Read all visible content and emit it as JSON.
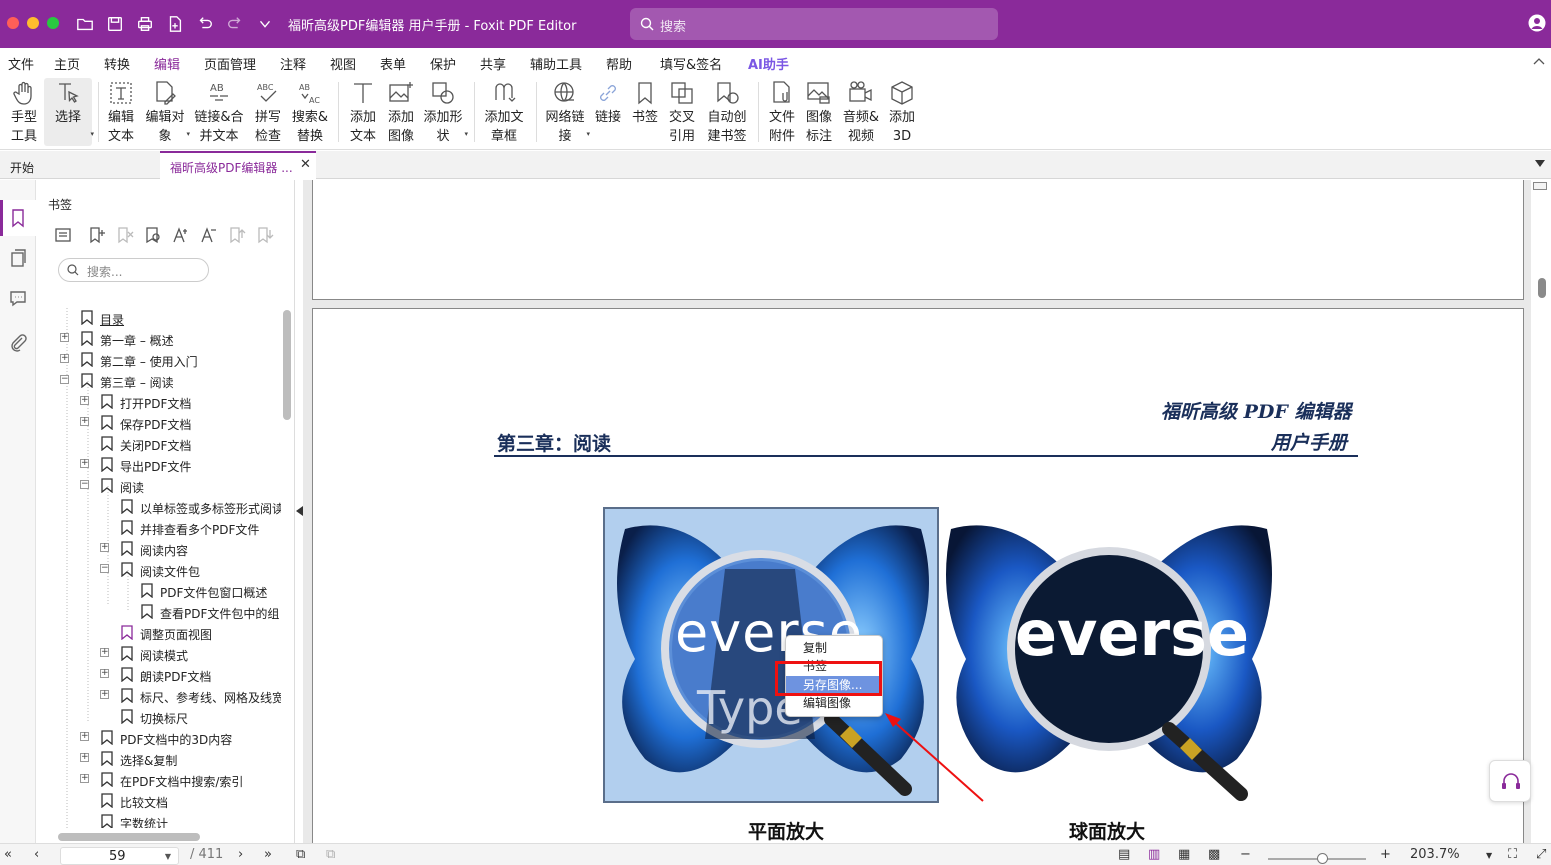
{
  "window": {
    "title": "福昕高级PDF编辑器 用户手册 - Foxit PDF Editor",
    "search_placeholder": "搜索",
    "colors": {
      "brand": "#8a2a9a",
      "close": "#ff5f57",
      "minimize": "#febc2e",
      "zoom": "#28c840"
    }
  },
  "menu": {
    "items": [
      "文件",
      "主页",
      "转换",
      "编辑",
      "页面管理",
      "注释",
      "视图",
      "表单",
      "保护",
      "共享",
      "辅助工具",
      "帮助",
      "填写&签名",
      "AI助手"
    ],
    "active": "编辑"
  },
  "ribbon": {
    "hand": "手型\n工具",
    "select": "选择",
    "edit_text": "编辑\n文本",
    "edit_object": "编辑对\n象",
    "link_merge": "链接&合\n并文本",
    "spell_check": "拼写\n检查",
    "search_replace": "搜索&\n替换",
    "add_text": "添加\n文本",
    "add_image": "添加\n图像",
    "add_shape": "添加形\n状",
    "add_text_box": "添加文\n章框",
    "web_links": "网络链\n接",
    "link": "链接",
    "bookmark": "书签",
    "cross_ref": "交叉\n引用",
    "auto_bookmark": "自动创\n建书签",
    "file_attachment": "文件\n附件",
    "image_annotation": "图像\n标注",
    "audio_video": "音频&\n视频",
    "add_3d": "添加\n3D"
  },
  "tabs": {
    "home": "开始",
    "document": "福昕高级PDF编辑器 ..."
  },
  "bookmarks": {
    "title": "书签",
    "search_placeholder": "搜索...",
    "items": [
      "目录",
      "第一章 – 概述",
      "第二章 – 使用入门",
      "第三章 – 阅读",
      "打开PDF文档",
      "保存PDF文档",
      "关闭PDF文档",
      "导出PDF文件",
      "阅读",
      "以单标签或多标签形式阅读",
      "并排查看多个PDF文件",
      "阅读内容",
      "阅读文件包",
      "PDF文件包窗口概述",
      "查看PDF文件包中的组",
      "调整页面视图",
      "阅读模式",
      "朗读PDF文档",
      "标尺、参考线、网格及线宽",
      "切换标尺",
      "PDF文档中的3D内容",
      "选择&复制",
      "在PDF文档中搜索/索引",
      "比较文档",
      "字数统计"
    ]
  },
  "document": {
    "header_right_1": "福昕高级 PDF 编辑器",
    "header_right_2": "用户手册",
    "chapter": "第三章：阅读",
    "caption_left": "平面放大",
    "caption_right": "球面放大",
    "image_word": "everse",
    "image_word_lower": "Type",
    "context_menu": [
      "复制",
      "书签",
      "另存图像...",
      "编辑图像"
    ],
    "context_menu_highlight": "另存图像..."
  },
  "status": {
    "current_page": "59",
    "total_pages": "/ 411",
    "zoom": "203.7%",
    "zoom_level_fraction": 0.56
  }
}
